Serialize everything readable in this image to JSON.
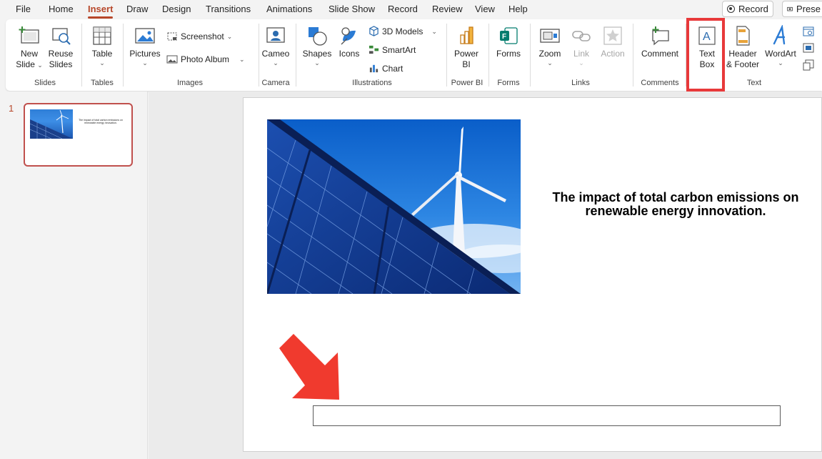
{
  "menu": {
    "tabs": [
      "File",
      "Home",
      "Insert",
      "Draw",
      "Design",
      "Transitions",
      "Animations",
      "Slide Show",
      "Record",
      "Review",
      "View",
      "Help"
    ],
    "active_tab": "Insert",
    "record_btn": "Record",
    "present_btn": "Prese"
  },
  "ribbon": {
    "new_slide": [
      "New",
      "Slide"
    ],
    "reuse_slides": [
      "Reuse",
      "Slides"
    ],
    "table": "Table",
    "pictures": "Pictures",
    "screenshot": "Screenshot",
    "photo_album": "Photo Album",
    "cameo": "Cameo",
    "shapes": "Shapes",
    "icons": "Icons",
    "models_3d": "3D Models",
    "smartart": "SmartArt",
    "chart": "Chart",
    "power_bi": [
      "Power",
      "BI"
    ],
    "forms": "Forms",
    "zoom": "Zoom",
    "link": "Link",
    "action": "Action",
    "comment": "Comment",
    "text_box": [
      "Text",
      "Box"
    ],
    "header_footer": [
      "Header",
      "& Footer"
    ],
    "wordart": "WordArt",
    "groups": {
      "slides": "Slides",
      "tables": "Tables",
      "images": "Images",
      "camera": "Camera",
      "illustrations": "Illustrations",
      "power_bi": "Power BI",
      "forms": "Forms",
      "links": "Links",
      "comments": "Comments",
      "text": "Text"
    }
  },
  "thumbnails": {
    "slide_number": "1",
    "thumb_text": "The impact of total carbon emissions on renewable energy innovation."
  },
  "slide": {
    "title_line1": "The impact of total carbon emissions on",
    "title_line2": "renewable energy innovation."
  },
  "colors": {
    "accent": "#b7472a",
    "highlight": "#e8393a",
    "arrow": "#f03a2e"
  }
}
